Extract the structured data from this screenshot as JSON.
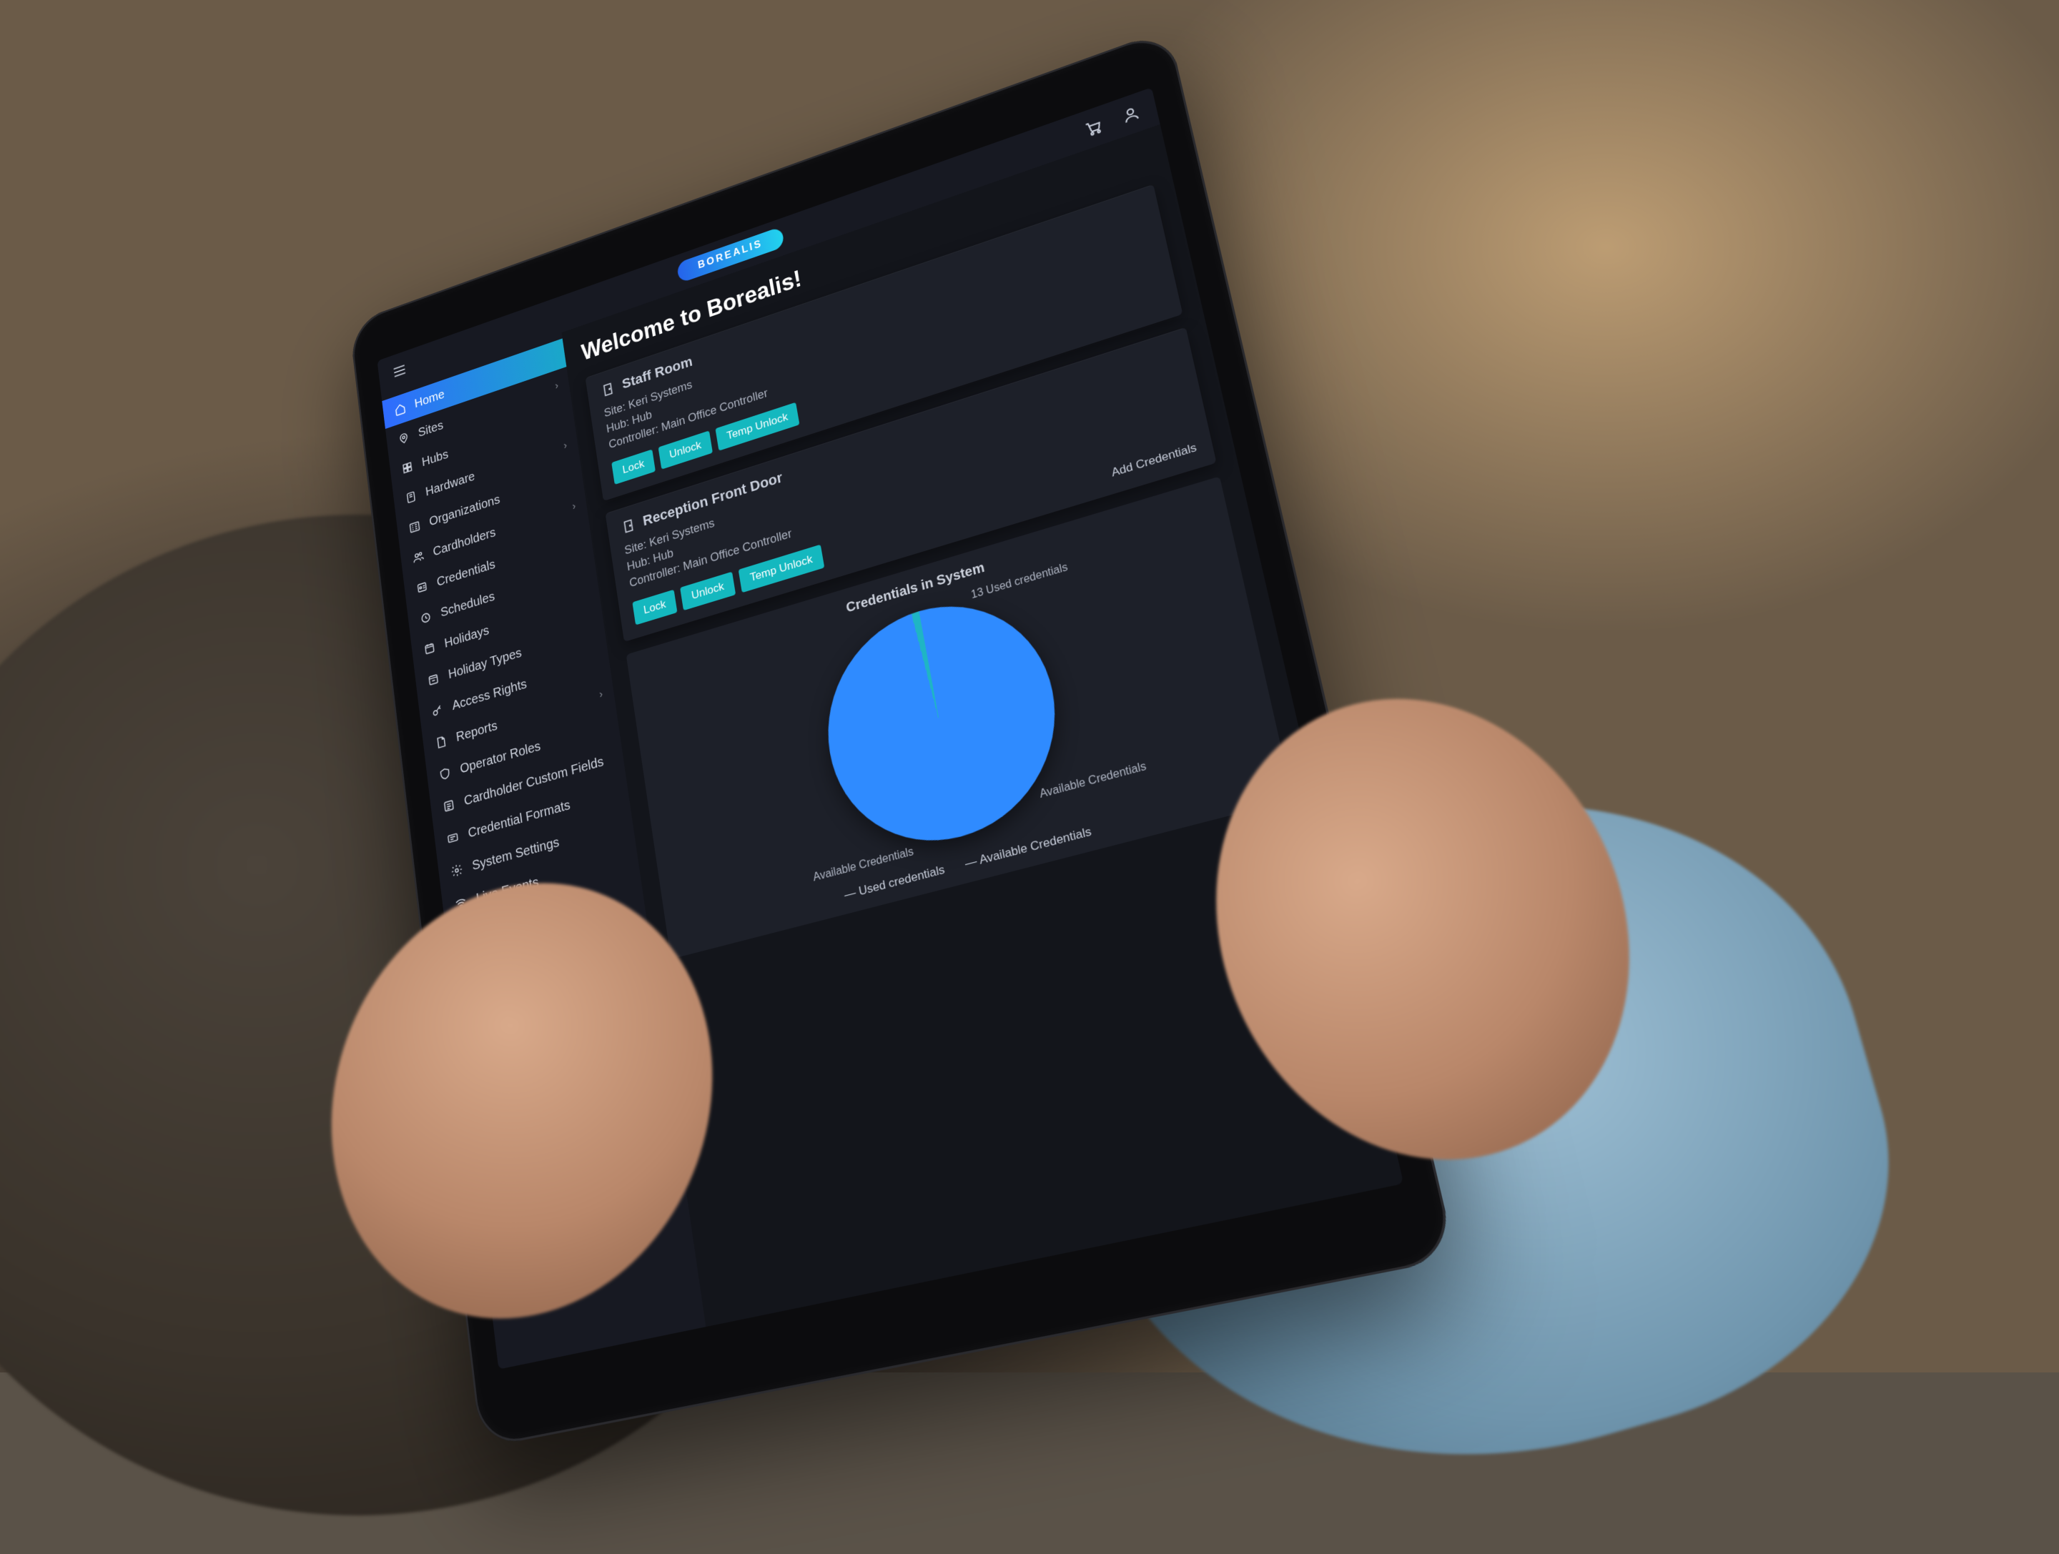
{
  "brand": "BOREALIS",
  "topbar": {
    "cart_icon": "cart-icon",
    "user_icon": "user-icon",
    "menu_icon": "menu-icon"
  },
  "sidebar": {
    "items": [
      {
        "label": "Home",
        "icon": "home-icon",
        "active": true,
        "expandable": false
      },
      {
        "label": "Sites",
        "icon": "site-pin-icon",
        "expandable": true
      },
      {
        "label": "Hubs",
        "icon": "hub-icon",
        "expandable": false
      },
      {
        "label": "Hardware",
        "icon": "hardware-icon",
        "expandable": true
      },
      {
        "label": "Organizations",
        "icon": "org-icon",
        "expandable": false
      },
      {
        "label": "Cardholders",
        "icon": "users-icon",
        "expandable": true
      },
      {
        "label": "Credentials",
        "icon": "badge-icon",
        "expandable": false
      },
      {
        "label": "Schedules",
        "icon": "clock-icon",
        "expandable": false
      },
      {
        "label": "Holidays",
        "icon": "calendar-icon",
        "expandable": false
      },
      {
        "label": "Holiday Types",
        "icon": "calendar-type-icon",
        "expandable": false
      },
      {
        "label": "Access Rights",
        "icon": "key-icon",
        "expandable": false
      },
      {
        "label": "Reports",
        "icon": "report-icon",
        "expandable": true
      },
      {
        "label": "Operator Roles",
        "icon": "shield-icon",
        "expandable": false
      },
      {
        "label": "Cardholder Custom Fields",
        "icon": "fields-icon",
        "expandable": false
      },
      {
        "label": "Credential Formats",
        "icon": "format-icon",
        "expandable": false
      },
      {
        "label": "System Settings",
        "icon": "gear-icon",
        "expandable": false
      },
      {
        "label": "Live Events",
        "icon": "wifi-icon",
        "expandable": false
      }
    ]
  },
  "main": {
    "title": "Welcome to Borealis!",
    "doors": [
      {
        "name": "Staff Room",
        "site_label": "Site:",
        "site": "Keri Systems",
        "hub_label": "Hub:",
        "hub": "Hub",
        "controller_label": "Controller:",
        "controller": "Main Office Controller",
        "buttons": {
          "lock": "Lock",
          "unlock": "Unlock",
          "temp": "Temp Unlock"
        }
      },
      {
        "name": "Reception Front Door",
        "site_label": "Site:",
        "site": "Keri Systems",
        "hub_label": "Hub:",
        "hub": "Hub",
        "controller_label": "Controller:",
        "controller": "Main Office Controller",
        "buttons": {
          "lock": "Lock",
          "unlock": "Unlock",
          "temp": "Temp Unlock"
        },
        "right_link": "Add Credentials"
      }
    ],
    "chart": {
      "title": "Credentials in System",
      "callout_used": "13 Used credentials",
      "callout_available": "Available Credentials",
      "bottom_label": "Available Credentials",
      "legend_used": "Used credentials",
      "legend_available": "Available Credentials"
    }
  },
  "chart_data": {
    "type": "pie",
    "title": "Credentials in System",
    "series": [
      {
        "name": "Used credentials",
        "value": 13,
        "color": "#2f8bff"
      },
      {
        "name": "Available Credentials",
        "value": 0.15,
        "color": "#1fb5c4"
      }
    ],
    "legend_position": "bottom"
  }
}
